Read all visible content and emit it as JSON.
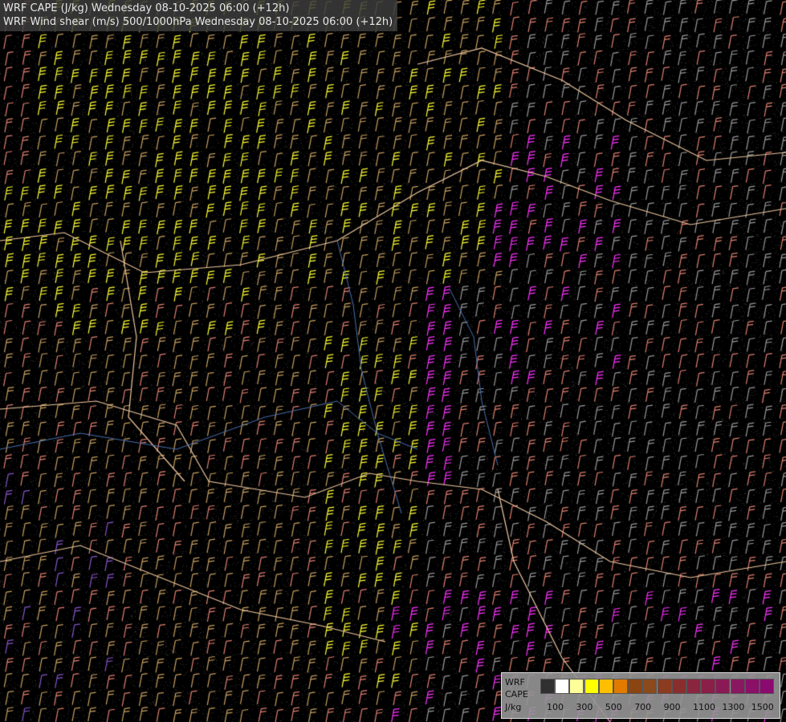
{
  "header": {
    "line1": "WRF CAPE (J/kg) Wednesday 08-10-2025 06:00 (+12h)",
    "line2": "WRF Wind shear (m/s) 500/1000hPa Wednesday 08-10-2025 06:00 (+12h)"
  },
  "legend": {
    "label_model": "WRF",
    "label_field": "CAPE",
    "label_unit": "J/kg",
    "ticks": [
      "100",
      "300",
      "500",
      "700",
      "900",
      "1100",
      "1300",
      "1500"
    ],
    "colors": [
      "#303030",
      "#ffffff",
      "#ffff99",
      "#ffff00",
      "#ffbf00",
      "#e07b00",
      "#8b4513",
      "#8a4a1c",
      "#8a3b20",
      "#8a2d2d",
      "#8a2540",
      "#8a1f48",
      "#8a1a55",
      "#8a1860",
      "#8a1068",
      "#8a0a70"
    ]
  },
  "map": {
    "background": "#000000",
    "barb_colors": {
      "yellow": "#ffff33",
      "tan": "#c8a060",
      "salmon": "#e08070",
      "magenta": "#ff33ff",
      "purple": "#8855cc",
      "grey": "#9a9a9a"
    },
    "border_color": "#f0c8a0",
    "river_color": "#4a6fb0"
  }
}
